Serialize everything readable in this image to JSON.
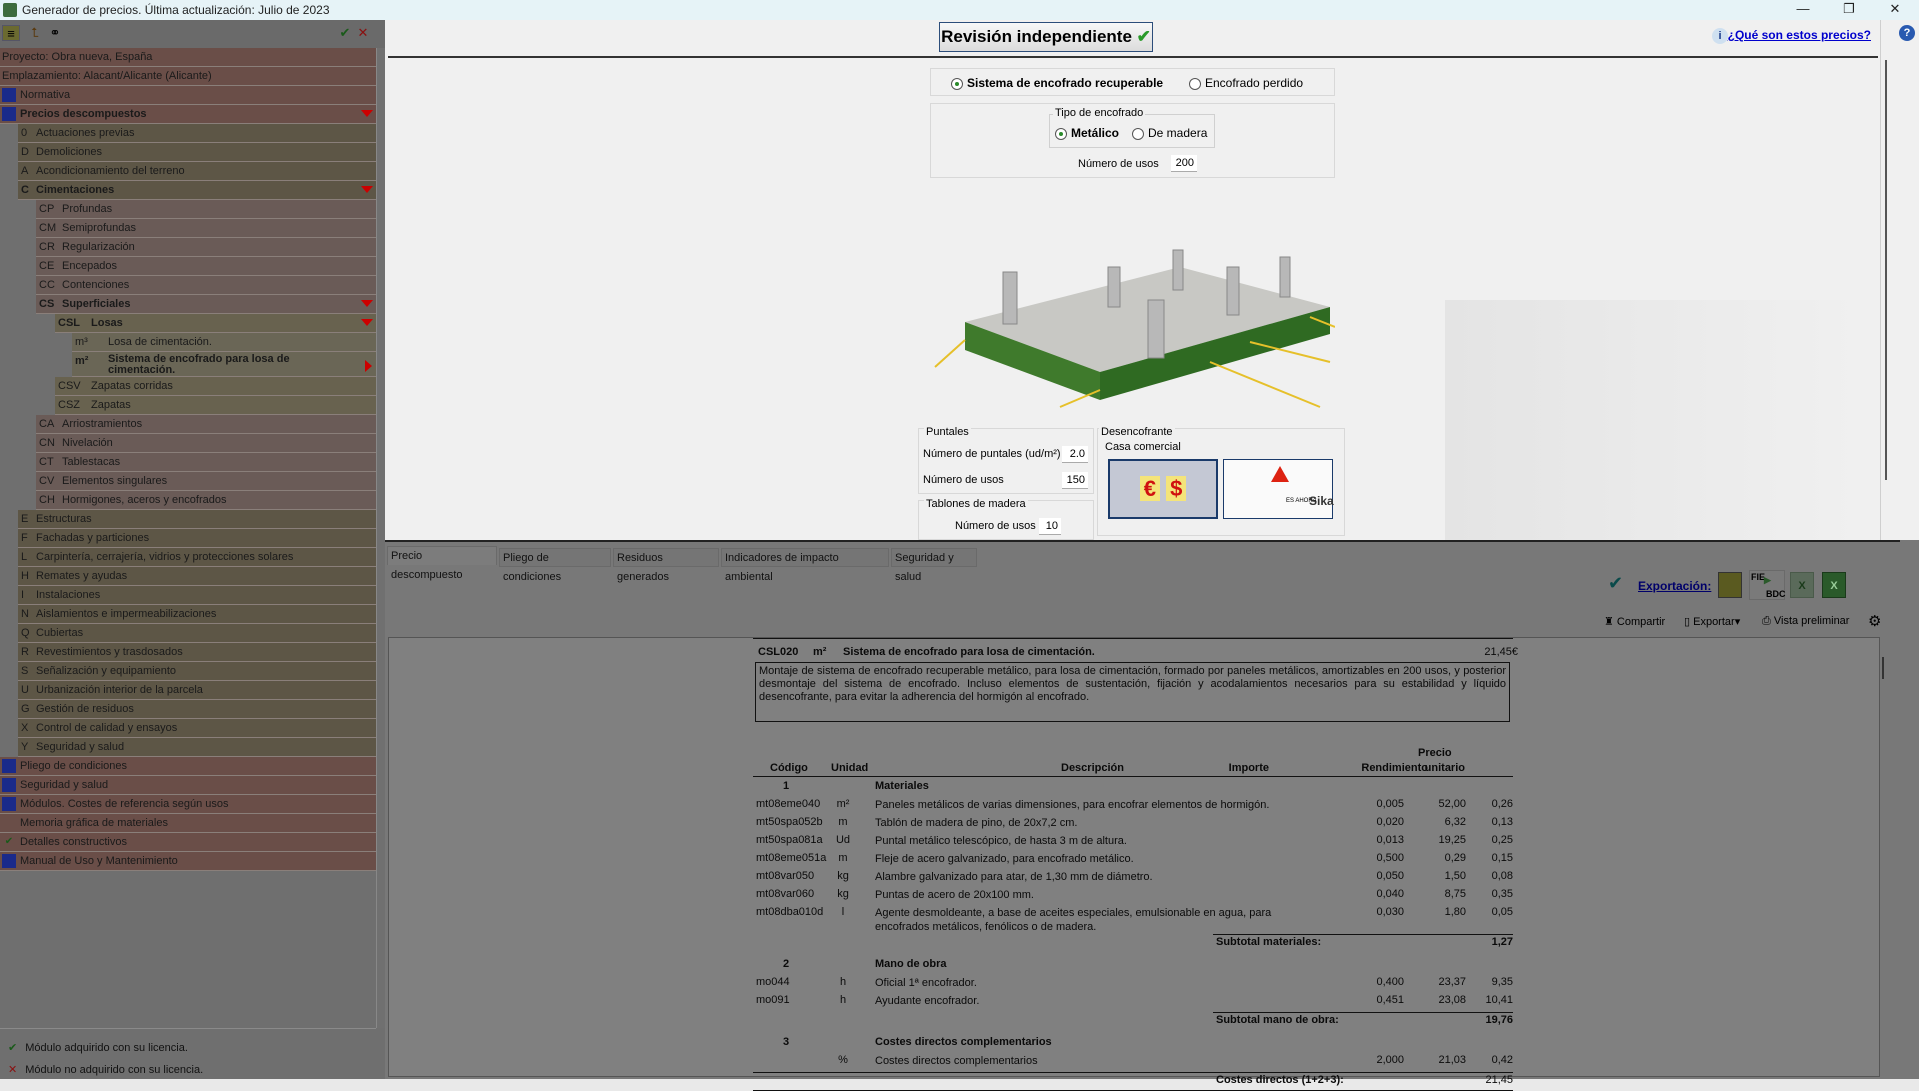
{
  "window": {
    "title": "Generador de precios. Última actualización: Julio de 2023",
    "minimize": "—",
    "restore": "❐",
    "close": "✕"
  },
  "sidebar": {
    "toolbar": {
      "ok": "✔",
      "cancel": "✕"
    },
    "items": [
      {
        "label": "Proyecto: Obra nueva, España",
        "level": 0,
        "code": ""
      },
      {
        "label": "Emplazamiento: Alacant/Alicante (Alicante)",
        "level": 0,
        "code": ""
      },
      {
        "label": "Normativa",
        "level": 0,
        "icon": "balance-icon",
        "code": ""
      },
      {
        "label": "Precios descompuestos",
        "level": 0,
        "icon": "euro-icon",
        "bold": true,
        "expanded": true,
        "code": ""
      },
      {
        "code": "0",
        "label": "Actuaciones previas",
        "level": 1
      },
      {
        "code": "D",
        "label": "Demoliciones",
        "level": 1
      },
      {
        "code": "A",
        "label": "Acondicionamiento del terreno",
        "level": 1
      },
      {
        "code": "C",
        "label": "Cimentaciones",
        "level": 1,
        "bold": true,
        "expanded": true
      },
      {
        "code": "CP",
        "label": "Profundas",
        "level": 2
      },
      {
        "code": "CM",
        "label": "Semiprofundas",
        "level": 2
      },
      {
        "code": "CR",
        "label": "Regularización",
        "level": 2
      },
      {
        "code": "CE",
        "label": "Encepados",
        "level": 2
      },
      {
        "code": "CC",
        "label": "Contenciones",
        "level": 2
      },
      {
        "code": "CS",
        "label": "Superficiales",
        "level": 2,
        "bold": true,
        "expanded": true
      },
      {
        "code": "CSL",
        "label": "Losas",
        "level": 3,
        "bold": true,
        "expanded": true
      },
      {
        "code": "m³",
        "label": "Losa de cimentación.",
        "level": 4
      },
      {
        "code": "m²",
        "label": "Sistema de encofrado para losa de cimentación.",
        "level": 4,
        "bold": true,
        "selected": true
      },
      {
        "code": "CSV",
        "label": "Zapatas corridas",
        "level": 3
      },
      {
        "code": "CSZ",
        "label": "Zapatas",
        "level": 3
      },
      {
        "code": "CA",
        "label": "Arriostramientos",
        "level": 2
      },
      {
        "code": "CN",
        "label": "Nivelación",
        "level": 2
      },
      {
        "code": "CT",
        "label": "Tablestacas",
        "level": 2
      },
      {
        "code": "CV",
        "label": "Elementos singulares",
        "level": 2
      },
      {
        "code": "CH",
        "label": "Hormigones, aceros y encofrados",
        "level": 2
      },
      {
        "code": "E",
        "label": "Estructuras",
        "level": 1
      },
      {
        "code": "F",
        "label": "Fachadas y particiones",
        "level": 1
      },
      {
        "code": "L",
        "label": "Carpintería, cerrajería, vidrios y protecciones solares",
        "level": 1
      },
      {
        "code": "H",
        "label": "Remates y ayudas",
        "level": 1
      },
      {
        "code": "I",
        "label": "Instalaciones",
        "level": 1
      },
      {
        "code": "N",
        "label": "Aislamientos e impermeabilizaciones",
        "level": 1
      },
      {
        "code": "Q",
        "label": "Cubiertas",
        "level": 1
      },
      {
        "code": "R",
        "label": "Revestimientos y trasdosados",
        "level": 1
      },
      {
        "code": "S",
        "label": "Señalización y equipamiento",
        "level": 1
      },
      {
        "code": "U",
        "label": "Urbanización interior de la parcela",
        "level": 1
      },
      {
        "code": "G",
        "label": "Gestión de residuos",
        "level": 1
      },
      {
        "code": "X",
        "label": "Control de calidad y ensayos",
        "level": 1
      },
      {
        "code": "Y",
        "label": "Seguridad y salud",
        "level": 1
      },
      {
        "label": "Pliego de condiciones",
        "level": 0,
        "icon": "scroll-icon",
        "code": ""
      },
      {
        "label": "Seguridad y salud",
        "level": 0,
        "icon": "helmet-icon",
        "code": ""
      },
      {
        "label": "Módulos. Costes de referencia según usos",
        "level": 0,
        "icon": "m2-icon",
        "code": ""
      },
      {
        "label": "Memoria gráfica de materiales",
        "level": 0,
        "code": ""
      },
      {
        "label": "Detalles constructivos",
        "level": 0,
        "icon": "check-icon",
        "code": ""
      },
      {
        "label": "Manual de Uso y Mantenimiento",
        "level": 0,
        "icon": "wrench-icon",
        "code": ""
      }
    ],
    "legend": {
      "acquired": "Módulo adquirido con su licencia.",
      "not_acquired": "Módulo no adquirido con su licencia."
    }
  },
  "top": {
    "review_button": "Revisión independiente",
    "help_link": "¿Qué son estos precios?",
    "system": {
      "options": [
        "Sistema de encofrado recuperable",
        "Encofrado perdido"
      ],
      "selected": 0
    },
    "tipo": {
      "label": "Tipo de encofrado",
      "options": [
        "Metálico",
        "De madera"
      ],
      "selected": 0
    },
    "usos_label": "Número de usos",
    "usos_value": "200",
    "puntales": {
      "label": "Puntales",
      "n_label": "Número de puntales (ud/m²)",
      "n_value": "2.0",
      "usos_label": "Número de usos",
      "usos_value": "150"
    },
    "tablones": {
      "label": "Tablones de madera",
      "usos_label": "Número de usos",
      "usos_value": "10"
    },
    "desencofrante": {
      "label": "Desencofrante",
      "casa_label": "Casa comercial",
      "brand": "Sika",
      "brand_sub": "ES AHORA"
    }
  },
  "bottom": {
    "tabs": [
      "Precio descompuesto",
      "Pliego de condiciones",
      "Residuos generados",
      "Indicadores de impacto ambiental",
      "Seguridad y salud"
    ],
    "active_tab": 0,
    "export_label": "Exportación:",
    "fie": "FIE",
    "bdc": "BDC",
    "compartir": "Compartir",
    "exportar": "Exportar",
    "vista": "Vista preliminar"
  },
  "doc": {
    "code": "CSL020",
    "unit": "m²",
    "title": "Sistema de encofrado para losa de cimentación.",
    "price": "21,45€",
    "description": "Montaje de sistema de encofrado recuperable metálico, para losa de cimentación, formado por paneles metálicos, amortizables en 200 usos, y posterior desmontaje del sistema de encofrado. Incluso elementos de sustentación, fijación y acodalamientos necesarios para su estabilidad y líquido desencofrante, para evitar la adherencia del hormigón al encofrado.",
    "headers": {
      "codigo": "Código",
      "unidad": "Unidad",
      "descripcion": "Descripción",
      "rendimiento": "Rendimiento",
      "precio1": "Precio",
      "precio2": "unitario",
      "importe": "Importe"
    },
    "groups": [
      {
        "num": "1",
        "title": "Materiales",
        "rows": [
          [
            "mt08eme040",
            "m²",
            "Paneles metálicos de varias dimensiones, para encofrar elementos de hormigón.",
            "0,005",
            "52,00",
            "0,26"
          ],
          [
            "mt50spa052b",
            "m",
            "Tablón de madera de pino, de 20x7,2 cm.",
            "0,020",
            "6,32",
            "0,13"
          ],
          [
            "mt50spa081a",
            "Ud",
            "Puntal metálico telescópico, de hasta 3 m de altura.",
            "0,013",
            "19,25",
            "0,25"
          ],
          [
            "mt08eme051a",
            "m",
            "Fleje de acero galvanizado, para encofrado metálico.",
            "0,500",
            "0,29",
            "0,15"
          ],
          [
            "mt08var050",
            "kg",
            "Alambre galvanizado para atar, de 1,30 mm de diámetro.",
            "0,050",
            "1,50",
            "0,08"
          ],
          [
            "mt08var060",
            "kg",
            "Puntas de acero de 20x100 mm.",
            "0,040",
            "8,75",
            "0,35"
          ],
          [
            "mt08dba010d",
            "l",
            "Agente desmoldeante, a base de aceites especiales, emulsionable en agua, para\nencofrados metálicos, fenólicos o de madera.",
            "0,030",
            "1,80",
            "0,05"
          ]
        ],
        "subtotal_label": "Subtotal materiales:",
        "subtotal": "1,27"
      },
      {
        "num": "2",
        "title": "Mano de obra",
        "rows": [
          [
            "mo044",
            "h",
            "Oficial 1ª encofrador.",
            "0,400",
            "23,37",
            "9,35"
          ],
          [
            "mo091",
            "h",
            "Ayudante encofrador.",
            "0,451",
            "23,08",
            "10,41"
          ]
        ],
        "subtotal_label": "Subtotal mano de obra:",
        "subtotal": "19,76"
      },
      {
        "num": "3",
        "title": "Costes directos complementarios",
        "rows": [
          [
            "",
            "%",
            "Costes directos complementarios",
            "2,000",
            "21,03",
            "0,42"
          ]
        ]
      }
    ],
    "total_label": "Costes directos (1+2+3):",
    "total": "21,45"
  }
}
